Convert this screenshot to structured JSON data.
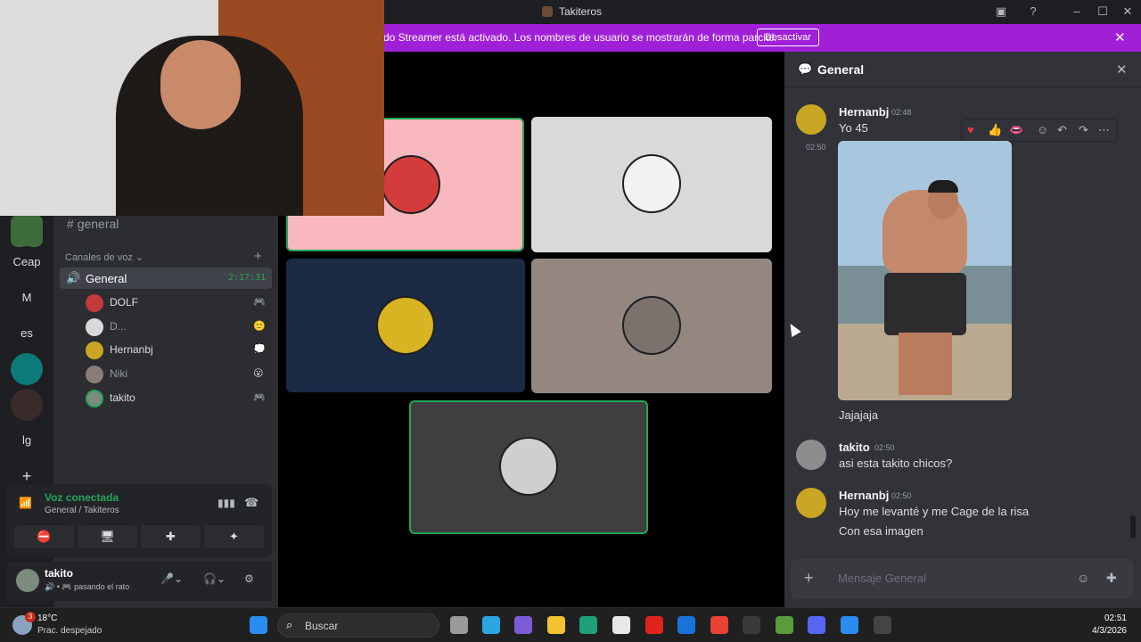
{
  "window": {
    "title": "Takiteros"
  },
  "banner": {
    "text": "do Streamer está activado. Los nombres de usuario se mostrarán de forma parcial.",
    "button": "Desactivar"
  },
  "rail": {
    "servers": [
      "Ceap",
      "M",
      "es",
      "lg"
    ]
  },
  "sidebar": {
    "text_channel": "general",
    "voice_header": "Canales de voz",
    "voice_channel": {
      "name": "General",
      "time": "2:17:31"
    },
    "members": [
      {
        "name": "DOLF",
        "status": "🎮"
      },
      {
        "name": "D...",
        "status": "🙂"
      },
      {
        "name": "Hernanbj",
        "status": "💭"
      },
      {
        "name": "Niki",
        "status": "😮"
      },
      {
        "name": "takito",
        "status": "🎮"
      }
    ]
  },
  "voice_connected": {
    "label": "Voz conectada",
    "sub": "General / Takiteros"
  },
  "user": {
    "name": "takito",
    "status": "pasando el rato"
  },
  "chat": {
    "header": "General",
    "messages": [
      {
        "author": "Hernanbj",
        "time": "02:48",
        "text": "Yo 45"
      },
      {
        "time": "02:50",
        "text": "Jajajaja"
      },
      {
        "author": "takito",
        "time": "02:50",
        "text": "asi esta takito chicos?"
      },
      {
        "author": "Hernanbj",
        "time": "02:50",
        "text": "Hoy me levanté y me Cage de la risa",
        "text2": "Con esa imagen"
      }
    ],
    "composer_placeholder": "Mensaje General"
  },
  "taskbar": {
    "weather_temp": "18°C",
    "weather_desc": "Prac. despejado",
    "weather_badge": "3",
    "search": "Buscar",
    "time": "02:51",
    "date": "4/3/2026"
  },
  "colors": {
    "accent": "#23a559",
    "banner": "#a020d8",
    "bg": "#313338"
  }
}
